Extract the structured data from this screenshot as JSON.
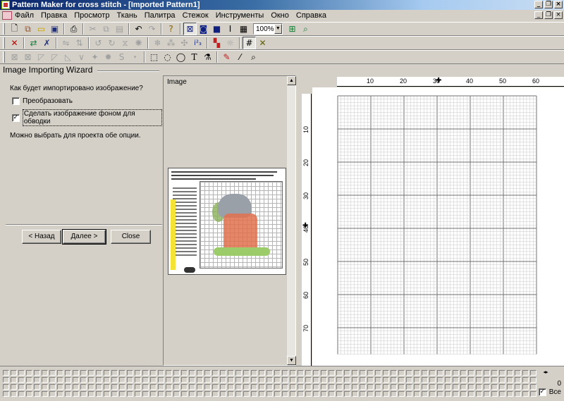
{
  "window": {
    "title": "Pattern Maker for cross stitch - [Imported Pattern1]",
    "controls": [
      "_",
      "❐",
      "×"
    ]
  },
  "menu": {
    "items": [
      "Файл",
      "Правка",
      "Просмотр",
      "Ткань",
      "Палитра",
      "Стежок",
      "Инструменты",
      "Окно",
      "Справка"
    ]
  },
  "toolbar": {
    "zoom_value": "100%",
    "zoom_arrow": "▼"
  },
  "wizard": {
    "title": "Image Importing Wizard",
    "question": "Как будет импортировано изображение?",
    "option_convert": "Преобразовать",
    "option_convert_checked": false,
    "option_background": "Сделать изображение фоном для обводки",
    "option_background_checked": true,
    "check_mark": "✓",
    "hint": "Можно выбрать для проекта обе опции.",
    "back_label": "< Назад",
    "next_label": "Далее >",
    "close_label": "Close"
  },
  "image_panel": {
    "label": "Image"
  },
  "pattern": {
    "h_ticks": [
      "10",
      "20",
      "30",
      "40",
      "50",
      "60"
    ],
    "v_ticks": [
      "10",
      "20",
      "30",
      "40",
      "50",
      "60",
      "70"
    ],
    "marker_top": "✚",
    "marker_left": "✚"
  },
  "bottom": {
    "count": "0",
    "all_label": "Все",
    "all_checked": true,
    "arrows": "◂▸"
  }
}
